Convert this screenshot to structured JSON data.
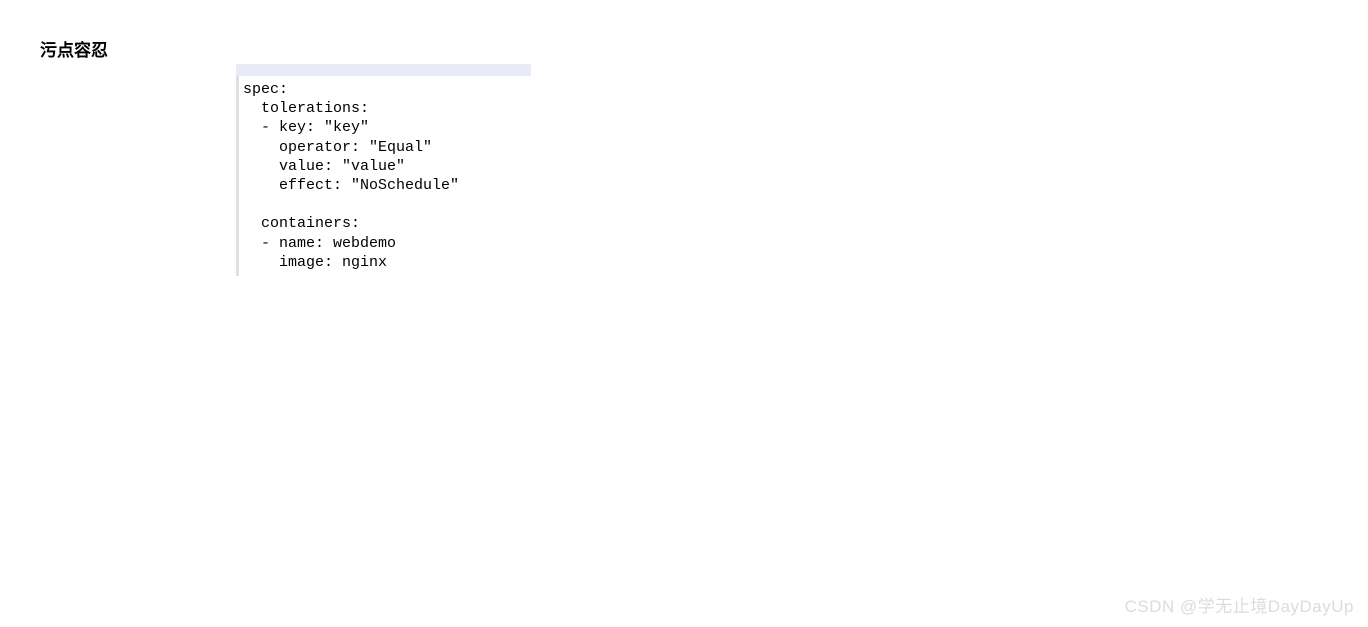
{
  "heading": "污点容忍",
  "code": {
    "lines": [
      "spec:",
      "  tolerations:",
      "  - key: \"key\"",
      "    operator: \"Equal\"",
      "    value: \"value\"",
      "    effect: \"NoSchedule\"",
      "",
      "  containers:",
      "  - name: webdemo",
      "    image: nginx"
    ]
  },
  "watermark": "CSDN @学无止境DayDayUp"
}
